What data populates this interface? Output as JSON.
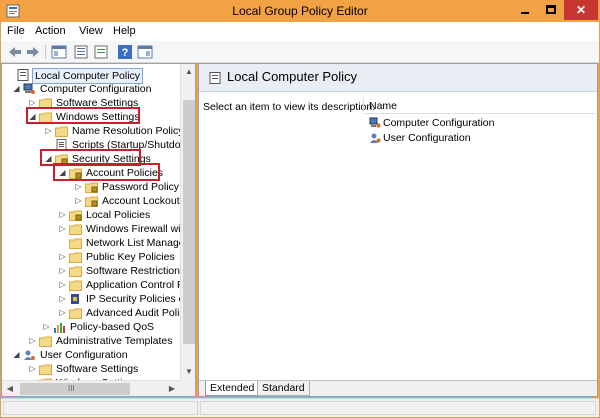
{
  "window": {
    "title": "Local Group Policy Editor",
    "min_glyph": "",
    "max_glyph": "",
    "close_glyph": "✕"
  },
  "menu": {
    "items": [
      "File",
      "Action",
      "View",
      "Help"
    ]
  },
  "toolbar": {
    "buttons": [
      "back-arrow-icon",
      "forward-arrow-icon",
      "show-hide-console-tree-icon",
      "properties-icon",
      "export-list-icon",
      "help-icon",
      "console-pane-icon"
    ]
  },
  "tree": {
    "items": [
      {
        "label": "Local Computer Policy",
        "icon": "computer-policy-icon",
        "expander": ""
      },
      {
        "label": "Computer Configuration",
        "icon": "computer-icon",
        "expander": "◢"
      },
      {
        "label": "Software Settings",
        "icon": "folder-icon",
        "expander": "▷"
      },
      {
        "label": "Windows Settings",
        "icon": "folder-icon",
        "expander": "◢"
      },
      {
        "label": "Name Resolution Policy",
        "icon": "folder-icon",
        "expander": "▷"
      },
      {
        "label": "Scripts (Startup/Shutdown)",
        "icon": "script-icon",
        "expander": ""
      },
      {
        "label": "Security Settings",
        "icon": "security-folder-icon",
        "expander": "◢"
      },
      {
        "label": "Account Policies",
        "icon": "security-folder-icon",
        "expander": "◢"
      },
      {
        "label": "Password Policy",
        "icon": "security-folder-icon",
        "expander": "▷"
      },
      {
        "label": "Account Lockout P",
        "icon": "security-folder-icon",
        "expander": "▷"
      },
      {
        "label": "Local Policies",
        "icon": "security-folder-icon",
        "expander": "▷"
      },
      {
        "label": "Windows Firewall with",
        "icon": "folder-icon",
        "expander": "▷"
      },
      {
        "label": "Network List Manager I",
        "icon": "folder-icon",
        "expander": ""
      },
      {
        "label": "Public Key Policies",
        "icon": "folder-icon",
        "expander": "▷"
      },
      {
        "label": "Software Restriction Po",
        "icon": "folder-icon",
        "expander": "▷"
      },
      {
        "label": "Application Control Po",
        "icon": "folder-icon",
        "expander": "▷"
      },
      {
        "label": "IP Security Policies on L",
        "icon": "ip-security-icon",
        "expander": "▷"
      },
      {
        "label": "Advanced Audit Policy",
        "icon": "folder-icon",
        "expander": "▷"
      },
      {
        "label": "Policy-based QoS",
        "icon": "qos-chart-icon",
        "expander": "▷"
      },
      {
        "label": "Administrative Templates",
        "icon": "folder-icon",
        "expander": "▷"
      },
      {
        "label": "User Configuration",
        "icon": "user-icon",
        "expander": "◢"
      },
      {
        "label": "Software Settings",
        "icon": "folder-icon",
        "expander": "▷"
      },
      {
        "label": "Windows Settings",
        "icon": "folder-icon",
        "expander": "▷"
      }
    ],
    "hscroll_label": "III"
  },
  "details": {
    "title": "Local Computer Policy",
    "description": "Select an item to view its description.",
    "column_name": "Name",
    "rows": [
      {
        "label": "Computer Configuration",
        "icon": "computer-icon"
      },
      {
        "label": "User Configuration",
        "icon": "user-icon"
      }
    ],
    "tabs": [
      "Extended",
      "Standard"
    ]
  },
  "colors": {
    "titlebar": "#f2a244",
    "close": "#c7372f",
    "highlight": "#c8202a"
  }
}
